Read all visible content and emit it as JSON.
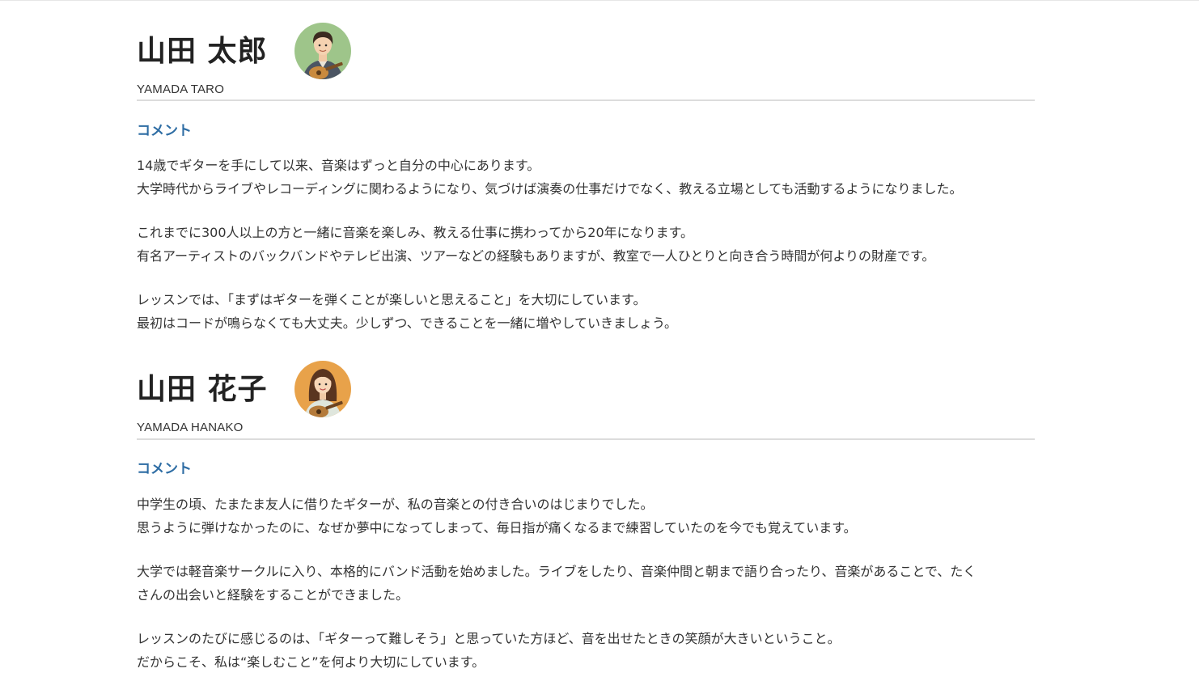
{
  "profiles": [
    {
      "name": "山田 太郎",
      "romaji": "YAMADA TARO",
      "avatar_icon": "guitarist-avatar-male",
      "comment_heading": "コメント",
      "paragraphs": [
        [
          "14歳でギターを手にして以来、音楽はずっと自分の中心にあります。",
          "大学時代からライブやレコーディングに関わるようになり、気づけば演奏の仕事だけでなく、教える立場としても活動するようになりました。"
        ],
        [
          "これまでに300人以上の方と一緒に音楽を楽しみ、教える仕事に携わってから20年になります。",
          "有名アーティストのバックバンドやテレビ出演、ツアーなどの経験もありますが、教室で一人ひとりと向き合う時間が何よりの財産です。"
        ],
        [
          "レッスンでは、「まずはギターを弾くことが楽しいと思えること」を大切にしています。",
          "最初はコードが鳴らなくても大丈夫。少しずつ、できることを一緒に増やしていきましょう。"
        ]
      ]
    },
    {
      "name": "山田 花子",
      "romaji": "YAMADA HANAKO",
      "avatar_icon": "guitarist-avatar-female",
      "comment_heading": "コメント",
      "paragraphs": [
        [
          "中学生の頃、たまたま友人に借りたギターが、私の音楽との付き合いのはじまりでした。",
          "思うように弾けなかったのに、なぜか夢中になってしまって、毎日指が痛くなるまで練習していたのを今でも覚えています。"
        ],
        [
          "大学では軽音楽サークルに入り、本格的にバンド活動を始めました。ライブをしたり、音楽仲間と朝まで語り合ったり、音楽があることで、たく",
          "さんの出会いと経験をすることができました。"
        ],
        [
          "レッスンのたびに感じるのは、「ギターって難しそう」と思っていた方ほど、音を出せたときの笑顔が大きいということ。",
          "だからこそ、私は“楽しむこと”を何より大切にしています。"
        ]
      ]
    }
  ],
  "colors": {
    "heading_accent": "#2e6da4",
    "text": "#333333",
    "divider": "#dcdcdc",
    "avatar1_bg": "#9ec58a",
    "avatar2_bg": "#e8a24a"
  }
}
